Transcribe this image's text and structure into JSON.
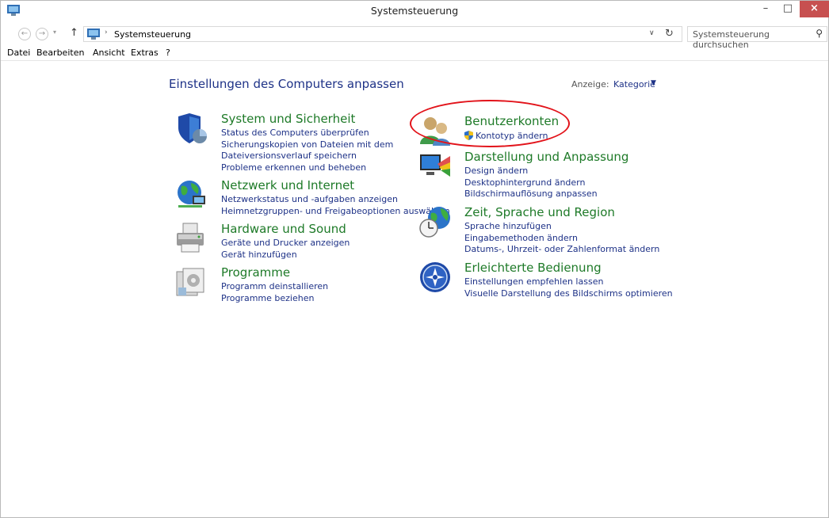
{
  "window": {
    "title": "Systemsteuerung",
    "minimize": "–",
    "maximize": "□",
    "close": "×"
  },
  "address": {
    "back": "←",
    "forward": "→",
    "recent": "▾",
    "up": "↑",
    "separator": "›",
    "path": "Systemsteuerung",
    "dropdown": "∨",
    "refresh": "↻",
    "search_placeholder": "Systemsteuerung durchsuchen",
    "search_icon": "⚲"
  },
  "menu": [
    "Datei",
    "Bearbeiten",
    "Ansicht",
    "Extras",
    "?"
  ],
  "content": {
    "title": "Einstellungen des Computers anpassen",
    "view_label": "Anzeige:",
    "view_value": "Kategorie",
    "view_arrow": "▼"
  },
  "categories_left": [
    {
      "title": "System und Sicherheit",
      "icon": "shield-icon",
      "links": [
        "Status des Computers überprüfen",
        "Sicherungskopien von Dateien mit dem",
        "Dateiversionsverlauf speichern",
        "Probleme erkennen und beheben"
      ]
    },
    {
      "title": "Netzwerk und Internet",
      "icon": "network-globe-icon",
      "links": [
        "Netzwerkstatus und -aufgaben anzeigen",
        "Heimnetzgruppen- und Freigabeoptionen auswählen"
      ]
    },
    {
      "title": "Hardware und Sound",
      "icon": "printer-icon",
      "links": [
        "Geräte und Drucker anzeigen",
        "Gerät hinzufügen"
      ]
    },
    {
      "title": "Programme",
      "icon": "programs-icon",
      "links": [
        "Programm deinstallieren",
        "Programme beziehen"
      ]
    }
  ],
  "categories_right": [
    {
      "title": "Benutzerkonten",
      "icon": "users-icon",
      "links": [
        "Kontotyp ändern"
      ]
    },
    {
      "title": "Darstellung und Anpassung",
      "icon": "display-icon",
      "links": [
        "Design ändern",
        "Desktophintergrund ändern",
        "Bildschirmauflösung anpassen"
      ]
    },
    {
      "title": "Zeit, Sprache und Region",
      "icon": "clock-globe-icon",
      "links": [
        "Sprache hinzufügen",
        "Eingabemethoden ändern",
        "Datums-, Uhrzeit- oder Zahlenformat ändern"
      ]
    },
    {
      "title": "Erleichterte Bedienung",
      "icon": "accessibility-icon",
      "links": [
        "Einstellungen empfehlen lassen",
        "Visuelle Darstellung des Bildschirms optimieren"
      ]
    }
  ],
  "colors": {
    "category_title": "#1e7a28",
    "link": "#1e3287",
    "close_button": "#c75050",
    "highlight": "#e2131a"
  }
}
